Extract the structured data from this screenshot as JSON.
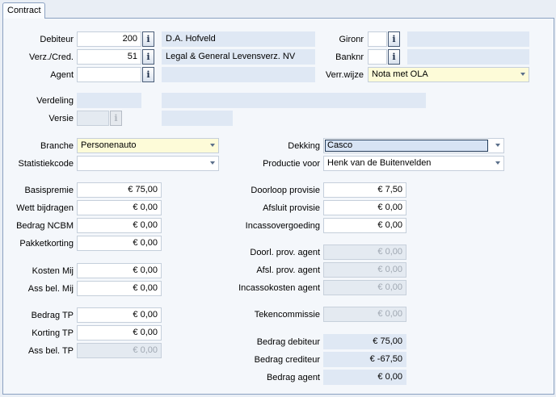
{
  "tab": {
    "label": "Contract"
  },
  "labels": {
    "debiteur": "Debiteur",
    "verz_cred": "Verz./Cred.",
    "agent": "Agent",
    "gironr": "Gironr",
    "banknr": "Banknr",
    "verr_wijze": "Verr.wijze",
    "verdeling": "Verdeling",
    "versie": "Versie",
    "branche": "Branche",
    "statistiekcode": "Statistiekcode",
    "dekking": "Dekking",
    "productie_voor": "Productie voor",
    "basispremie": "Basispremie",
    "wett_bijdragen": "Wett bijdragen",
    "bedrag_ncbm": "Bedrag NCBM",
    "pakketkorting": "Pakketkorting",
    "kosten_mij": "Kosten Mij",
    "ass_bel_mij": "Ass bel. Mij",
    "bedrag_tp": "Bedrag TP",
    "korting_tp": "Korting TP",
    "ass_bel_tp": "Ass bel. TP",
    "doorloop_provisie": "Doorloop provisie",
    "afsluit_provisie": "Afsluit provisie",
    "incassovergoeding": "Incassovergoeding",
    "doorl_prov_agent": "Doorl. prov. agent",
    "afsl_prov_agent": "Afsl. prov. agent",
    "incassokosten_agent": "Incassokosten agent",
    "tekencommissie": "Tekencommissie",
    "bedrag_debiteur": "Bedrag debiteur",
    "bedrag_crediteur": "Bedrag crediteur",
    "bedrag_agent": "Bedrag agent"
  },
  "values": {
    "debiteur": "200",
    "debiteur_name": "D.A. Hofveld",
    "verz_cred": "51",
    "verz_cred_name": "Legal & General Levensverz. NV",
    "agent": "",
    "agent_name": "",
    "gironr": "",
    "gironr_name": "",
    "banknr": "",
    "banknr_name": "",
    "verr_wijze": "Nota met OLA",
    "verdeling": "",
    "verdeling_desc": "",
    "versie": "",
    "versie_desc": "",
    "branche": "Personenauto",
    "statistiekcode": "",
    "dekking": "Casco",
    "productie_voor": "Henk van de Buitenvelden",
    "basispremie": "€ 75,00",
    "wett_bijdragen": "€ 0,00",
    "bedrag_ncbm": "€ 0,00",
    "pakketkorting": "€ 0,00",
    "kosten_mij": "€ 0,00",
    "ass_bel_mij": "€ 0,00",
    "bedrag_tp": "€ 0,00",
    "korting_tp": "€ 0,00",
    "ass_bel_tp": "€ 0,00",
    "doorloop_provisie": "€ 7,50",
    "afsluit_provisie": "€ 0,00",
    "incassovergoeding": "€ 0,00",
    "doorl_prov_agent": "€ 0,00",
    "afsl_prov_agent": "€ 0,00",
    "incassokosten_agent": "€ 0,00",
    "tekencommissie": "€ 0,00",
    "bedrag_debiteur": "€ 75,00",
    "bedrag_crediteur": "€ -67,50",
    "bedrag_agent": "€ 0,00"
  },
  "info_button_label": "i",
  "icons": {
    "info": "info-icon",
    "dropdown": "chevron-down-icon"
  },
  "colors": {
    "input_bg": "#ffffff",
    "readonly_bg": "#dfe8f4",
    "required_bg": "#fdfbd8",
    "panel_bg": "#f4f7fb",
    "border": "#8ba1c1"
  }
}
